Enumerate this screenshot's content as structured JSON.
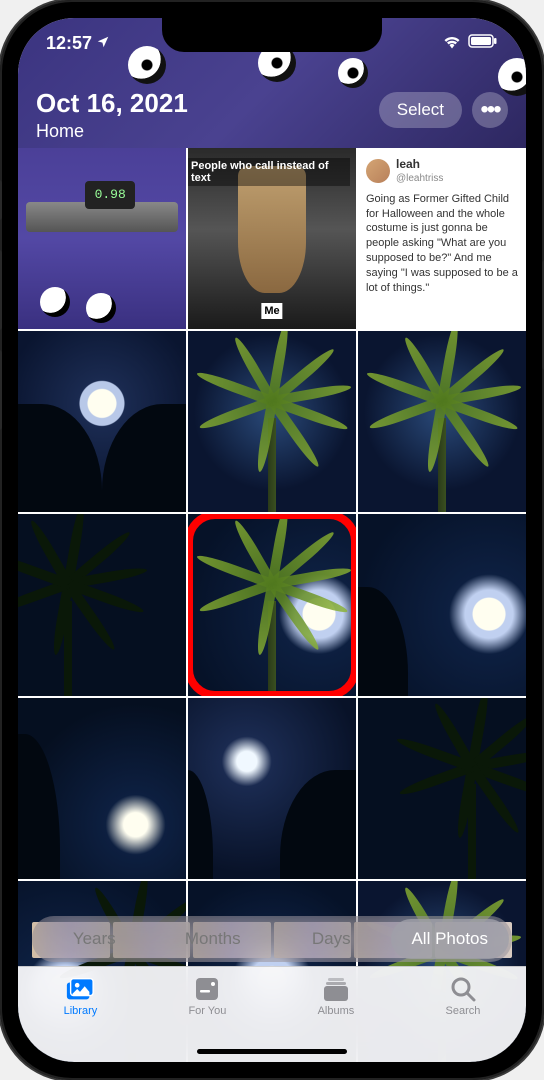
{
  "status": {
    "time": "12:57",
    "location_icon": "location-arrow"
  },
  "header": {
    "date": "Oct 16, 2021",
    "breadcrumb": "Home",
    "select_label": "Select",
    "more_label": "•••"
  },
  "grid": {
    "highlighted_index": 7,
    "cells": [
      {
        "kind": "caliper",
        "lcd": "0.98"
      },
      {
        "kind": "car_meme",
        "top_text": "People who call instead of text",
        "bottom_text": "Me"
      },
      {
        "kind": "tweet",
        "name": "leah",
        "handle": "@leahtriss",
        "body": "Going as Former Gifted Child for Halloween and the whole costume is just gonna be people asking \"What are you supposed to be?\" And me saying \"I was supposed to be a lot of things.\""
      },
      {
        "kind": "night_moon_center_trees"
      },
      {
        "kind": "palm_center_bright"
      },
      {
        "kind": "palm_center_bright"
      },
      {
        "kind": "palm_left_dark"
      },
      {
        "kind": "palm_moon_right"
      },
      {
        "kind": "night_moon_right_trees"
      },
      {
        "kind": "night_moon_lowright"
      },
      {
        "kind": "night_moon_silhouette"
      },
      {
        "kind": "palm_right_dark"
      },
      {
        "kind": "palm_moon_left"
      },
      {
        "kind": "night_moon_center"
      },
      {
        "kind": "palm_center_bright"
      }
    ]
  },
  "segments": {
    "items": [
      "Years",
      "Months",
      "Days",
      "All Photos"
    ],
    "active_index": 3
  },
  "tabs": {
    "items": [
      {
        "label": "Library",
        "icon": "library"
      },
      {
        "label": "For You",
        "icon": "foryou"
      },
      {
        "label": "Albums",
        "icon": "albums"
      },
      {
        "label": "Search",
        "icon": "search"
      }
    ],
    "active_index": 0
  }
}
